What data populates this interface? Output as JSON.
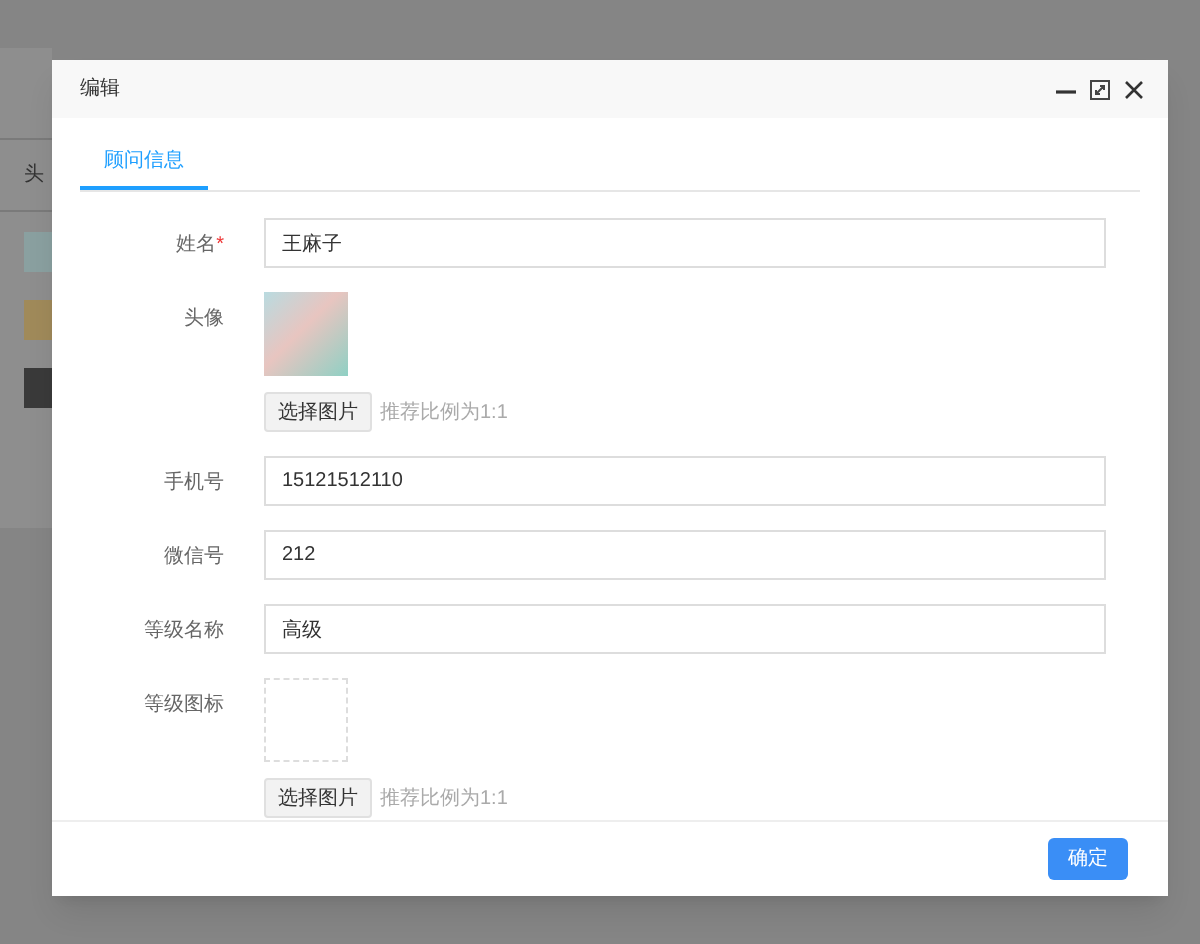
{
  "background": {
    "column_header": "头"
  },
  "dialog": {
    "title": "编辑",
    "tabs": [
      {
        "label": "顾问信息",
        "selected": true
      }
    ],
    "fields": [
      {
        "kind": "text",
        "label": "姓名",
        "required_mark": "*",
        "value": "王麻子"
      },
      {
        "kind": "image",
        "label": "头像",
        "has_image": true,
        "button": "选择图片",
        "hint": "推荐比例为1:1"
      },
      {
        "kind": "text",
        "label": "手机号",
        "value": "15121512110"
      },
      {
        "kind": "text",
        "label": "微信号",
        "value": "212"
      },
      {
        "kind": "text",
        "label": "等级名称",
        "value": "高级"
      },
      {
        "kind": "image",
        "label": "等级图标",
        "has_image": false,
        "button": "选择图片",
        "hint": "推荐比例为1:1"
      }
    ],
    "confirm_button": "确定"
  }
}
